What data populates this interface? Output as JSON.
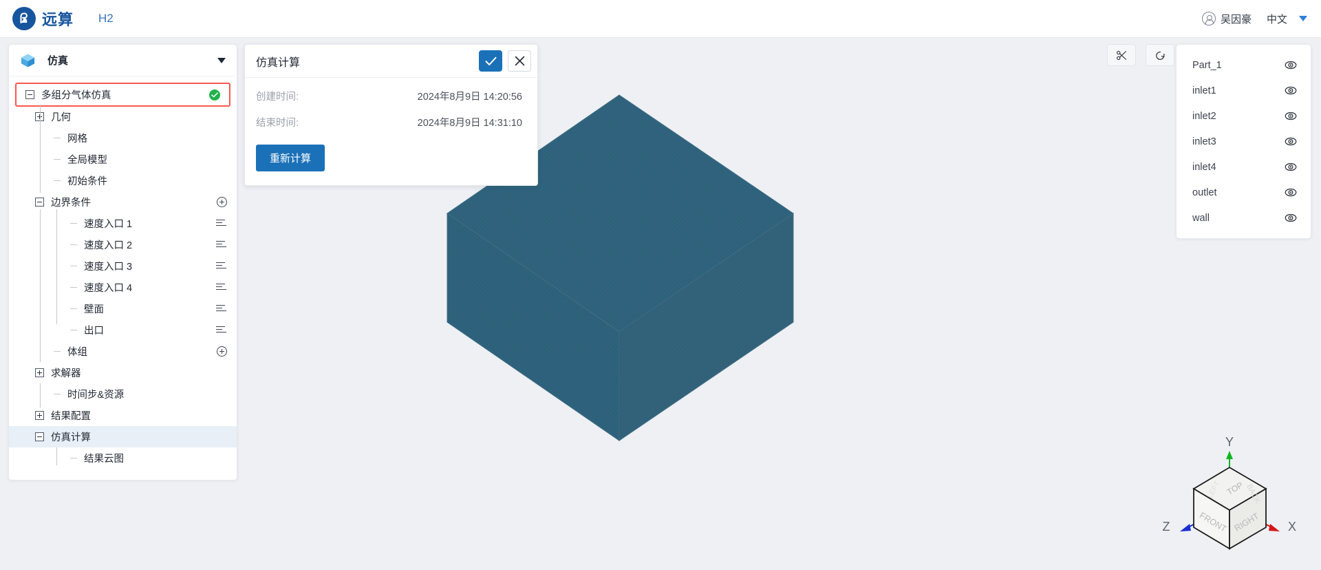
{
  "topbar": {
    "logo_icon": "yuansuan-logo-icon",
    "brand": "远算",
    "app": "H2",
    "user_icon": "user-avatar-icon",
    "user_name": "吴因豪",
    "language": "中文",
    "caret_icon": "chevron-down-icon"
  },
  "sidebar": {
    "header": {
      "icon": "cube-icon",
      "title": "仿真",
      "collapse_icon": "chevron-down-icon"
    },
    "tree": [
      {
        "label": "多组分气体仿真",
        "depth": 0,
        "toggle": "minus",
        "status": "done",
        "flagged": true
      },
      {
        "label": "几何",
        "depth": 1,
        "toggle": "plus"
      },
      {
        "label": "网格",
        "depth": 2,
        "toggle": "leaf"
      },
      {
        "label": "全局模型",
        "depth": 2,
        "toggle": "leaf"
      },
      {
        "label": "初始条件",
        "depth": 2,
        "toggle": "leaf"
      },
      {
        "label": "边界条件",
        "depth": 1,
        "toggle": "minus",
        "action": "add"
      },
      {
        "label": "速度入口 1",
        "depth": 3,
        "toggle": "leaf",
        "action": "list"
      },
      {
        "label": "速度入口 2",
        "depth": 3,
        "toggle": "leaf",
        "action": "list"
      },
      {
        "label": "速度入口 3",
        "depth": 3,
        "toggle": "leaf",
        "action": "list"
      },
      {
        "label": "速度入口 4",
        "depth": 3,
        "toggle": "leaf",
        "action": "list"
      },
      {
        "label": "壁面",
        "depth": 3,
        "toggle": "leaf",
        "action": "list"
      },
      {
        "label": "出口",
        "depth": 3,
        "toggle": "leaf",
        "action": "list"
      },
      {
        "label": "体组",
        "depth": 2,
        "toggle": "leaf",
        "action": "add"
      },
      {
        "label": "求解器",
        "depth": 1,
        "toggle": "plus"
      },
      {
        "label": "时间步&资源",
        "depth": 2,
        "toggle": "leaf"
      },
      {
        "label": "结果配置",
        "depth": 1,
        "toggle": "plus"
      },
      {
        "label": "仿真计算",
        "depth": 1,
        "toggle": "minus",
        "selected": true
      },
      {
        "label": "结果云图",
        "depth": 3,
        "toggle": "leaf"
      }
    ]
  },
  "property_panel": {
    "title": "仿真计算",
    "confirm_icon": "check-icon",
    "cancel_icon": "close-icon",
    "rows": [
      {
        "key": "创建时间:",
        "value": "2024年8月9日 14:20:56"
      },
      {
        "key": "结束时间:",
        "value": "2024年8月9日 14:31:10"
      }
    ],
    "action_button": "重新计算"
  },
  "view_toolbar": [
    {
      "name": "clip-scissors-icon"
    },
    {
      "name": "reset-view-icon"
    }
  ],
  "parts_panel": {
    "items": [
      {
        "name": "Part_1",
        "visibility_icon": "eye-icon"
      },
      {
        "name": "inlet1",
        "visibility_icon": "eye-icon"
      },
      {
        "name": "inlet2",
        "visibility_icon": "eye-icon"
      },
      {
        "name": "inlet3",
        "visibility_icon": "eye-icon"
      },
      {
        "name": "inlet4",
        "visibility_icon": "eye-icon"
      },
      {
        "name": "outlet",
        "visibility_icon": "eye-icon"
      },
      {
        "name": "wall",
        "visibility_icon": "eye-icon"
      }
    ]
  },
  "nav_cube": {
    "axis_x": "X",
    "axis_y": "Y",
    "axis_z": "Z",
    "face_top": "TOP",
    "face_front": "FRONT",
    "face_right": "RIGHT",
    "face_back": "BACK",
    "face_left": "LEFT"
  },
  "colors": {
    "brand_blue": "#17559e",
    "accent_blue": "#1b71b8",
    "model_teal": "#255d79",
    "status_green": "#22b14c",
    "flag_red": "#f8584f",
    "canvas_bg": "#eef0f4"
  }
}
